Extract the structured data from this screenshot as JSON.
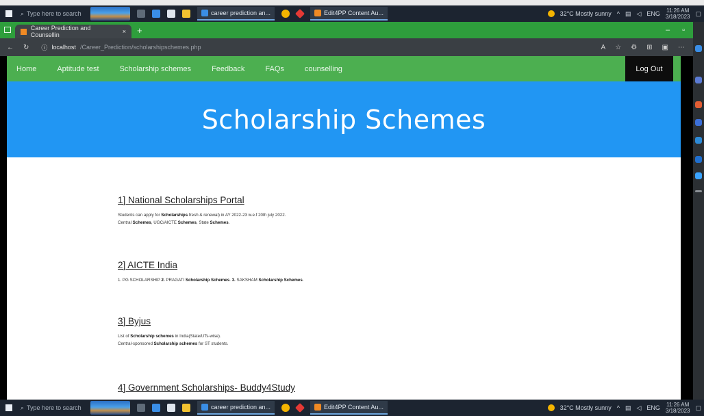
{
  "taskbar": {
    "search_placeholder": "Type here to search",
    "apps": [
      "career prediction an...",
      "Edit4PP Content Au..."
    ],
    "weather": "32°C  Mostly sunny",
    "lang": "ENG",
    "time": "11:26 AM",
    "date": "3/18/2023"
  },
  "browser": {
    "tab_title": "Career Prediction and Counsellin",
    "url_host": "localhost",
    "url_path": "/Career_Prediction/scholarshipschemes.php"
  },
  "nav": {
    "links": [
      "Home",
      "Aptitude test",
      "Scholarship schemes",
      "Feedback",
      "FAQs",
      "counselling"
    ],
    "logout": "Log Out"
  },
  "hero": {
    "title": "Scholarship Schemes"
  },
  "schemes": [
    {
      "title": "1] National Scholarships Portal",
      "lines": [
        [
          "Students can apply for ",
          "Scholarships",
          " fresh & renewal) in AY 2022-23 w.e.f 20th july 2022."
        ],
        [
          "Central ",
          "Schemes",
          ", UGC/AICTE ",
          "Schemes",
          ", State ",
          "Schemes",
          "."
        ]
      ]
    },
    {
      "title": "2] AICTE India",
      "lines": [
        [
          "1. PG SCHOLARSHIP ",
          "2.",
          " PRAGATI ",
          "Scholarship Schemes",
          ". ",
          "3.",
          " SAKSHAM ",
          "Scholarship Schemes",
          "."
        ]
      ]
    },
    {
      "title": "3] Byjus",
      "lines": [
        [
          "List of ",
          "Scholarship schemes",
          " in India(State/UTs-wise)."
        ],
        [
          "Central-sponsored ",
          "Scholarship schemes",
          " for ST students."
        ]
      ]
    },
    {
      "title": "4] Government Scholarships- Buddy4Study",
      "lines": []
    }
  ],
  "colors": {
    "nav_bg": "#4caf50",
    "hero_bg": "#2196f3",
    "logout_bg": "#0d0d0d",
    "tab_strip": "#2e9e3c"
  }
}
